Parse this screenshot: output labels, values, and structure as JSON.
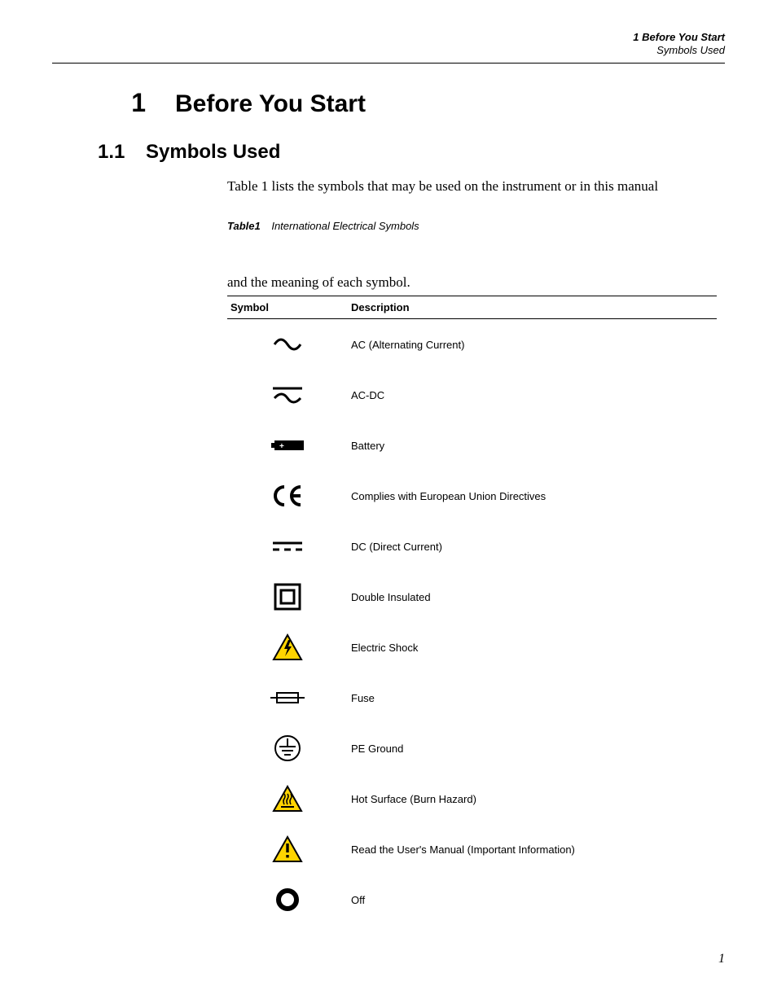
{
  "header": {
    "line1": "1  Before You Start",
    "line2": "Symbols Used"
  },
  "chapter": {
    "number": "1",
    "title": "Before You Start"
  },
  "section": {
    "number": "1.1",
    "title": "Symbols Used"
  },
  "intro_text": "Table 1 lists the symbols that may be used on the instrument or in this manual",
  "table_caption": {
    "label": "Table1",
    "text": "International Electrical Symbols"
  },
  "intro_text_2": "and the meaning of each symbol.",
  "table": {
    "headers": [
      "Symbol",
      "Description"
    ],
    "rows": [
      {
        "icon": "ac-icon",
        "description": "AC (Alternating Current)"
      },
      {
        "icon": "ac-dc-icon",
        "description": "AC-DC"
      },
      {
        "icon": "battery-icon",
        "description": "Battery"
      },
      {
        "icon": "ce-mark-icon",
        "description": "Complies with European Union Directives"
      },
      {
        "icon": "dc-icon",
        "description": "DC (Direct Current)"
      },
      {
        "icon": "double-insulated-icon",
        "description": "Double Insulated"
      },
      {
        "icon": "electric-shock-icon",
        "description": "Electric Shock"
      },
      {
        "icon": "fuse-icon",
        "description": "Fuse"
      },
      {
        "icon": "pe-ground-icon",
        "description": "PE Ground"
      },
      {
        "icon": "hot-surface-icon",
        "description": "Hot Surface (Burn Hazard)"
      },
      {
        "icon": "read-manual-icon",
        "description": "Read the User's Manual (Important Information)"
      },
      {
        "icon": "off-icon",
        "description": "Off"
      }
    ]
  },
  "page_number": "1"
}
